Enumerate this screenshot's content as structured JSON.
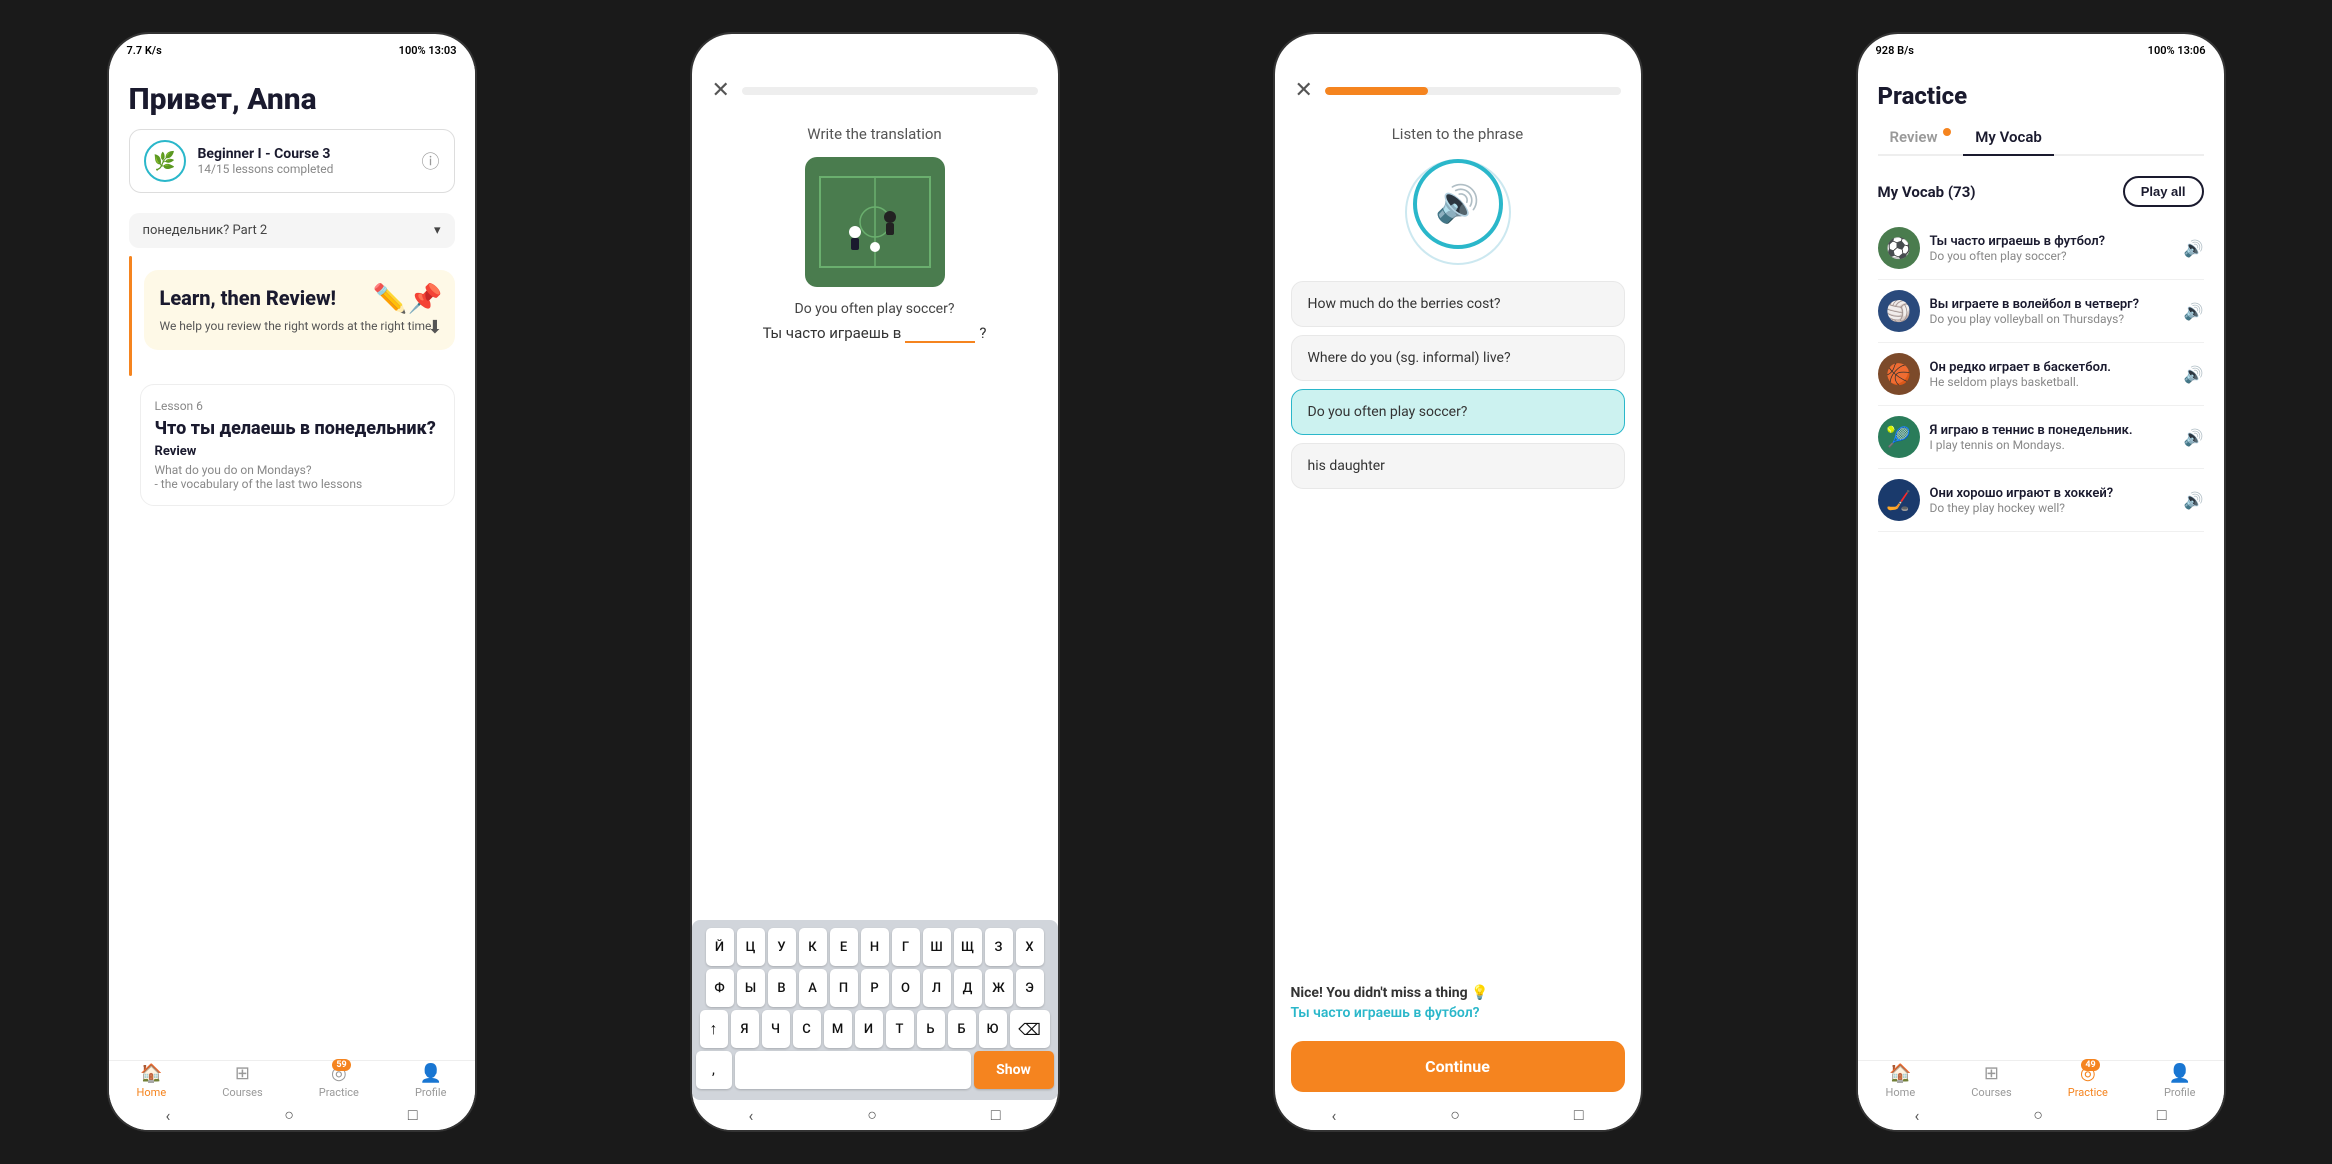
{
  "screens": [
    {
      "id": "screen1",
      "status_bar": {
        "left": "7.7 K/s",
        "right": "100% 13:03"
      },
      "greeting": "Привет, Anna",
      "course": {
        "name": "Beginner I - Course 3",
        "progress": "14/15 lessons completed"
      },
      "dropdown_text": "понедельник? Part 2",
      "review_card": {
        "title": "Learn, then Review!",
        "text": "We help you review the right words at the right time."
      },
      "lesson": {
        "number": "Lesson 6",
        "title": "Что ты делаешь в понедельник?",
        "subtitle": "Review",
        "desc": "What do you do on Mondays?\n- the vocabulary of the last two lessons"
      },
      "nav": {
        "home": "Home",
        "courses": "Courses",
        "practice": "Practice",
        "profile": "Profile",
        "badge": "59"
      }
    },
    {
      "id": "screen2",
      "instruction": "Write the translation",
      "phrase": "Do you often play soccer?",
      "translation_prefix": "Ты часто играешь в",
      "translation_suffix": "?",
      "keyboard_rows": [
        [
          "Й",
          "Ц",
          "У",
          "К",
          "Е",
          "Н",
          "Г",
          "Ш",
          "Щ",
          "З",
          "Х"
        ],
        [
          "Ф",
          "Ы",
          "В",
          "А",
          "П",
          "Р",
          "О",
          "Л",
          "Д",
          "Ж",
          "Э"
        ],
        [
          "↑",
          "Я",
          "Ч",
          "С",
          "М",
          "И",
          "Т",
          "Ь",
          "Б",
          "Ю",
          "⌫"
        ]
      ],
      "show_button": "Show"
    },
    {
      "id": "screen3",
      "instruction": "Listen to the phrase",
      "options": [
        "How much do the berries cost?",
        "Where do you (sg. informal) live?",
        "Do you often play soccer?",
        "his daughter"
      ],
      "selected_index": 2,
      "feedback": {
        "title": "Nice! You didn't miss a thing 💡",
        "correct": "Ты часто играешь в футбол?"
      },
      "continue_button": "Continue"
    },
    {
      "id": "screen4",
      "status_bar": {
        "left": "928 B/s",
        "right": "100% 13:06"
      },
      "title": "Practice",
      "tabs": [
        {
          "label": "Review",
          "has_dot": true,
          "active": false
        },
        {
          "label": "My Vocab",
          "has_dot": false,
          "active": true
        }
      ],
      "vocab_header": {
        "title": "My Vocab  (73)",
        "play_all": "Play all"
      },
      "vocab_items": [
        {
          "russian": "Ты часто играешь в футбол?",
          "english": "Do you often play soccer?",
          "emoji": "⚽"
        },
        {
          "russian": "Вы играете в волейбол в четверг?",
          "english": "Do you play volleyball on Thursdays?",
          "emoji": "🏐"
        },
        {
          "russian": "Он редко играет в баскетбол.",
          "english": "He seldom plays basketball.",
          "emoji": "🏀"
        },
        {
          "russian": "Я играю в теннис в понедельник.",
          "english": "I play tennis on Mondays.",
          "emoji": "🎾"
        },
        {
          "russian": "Они хорошо играют в хоккей?",
          "english": "Do they play hockey well?",
          "emoji": "🏒"
        }
      ],
      "nav": {
        "home": "Home",
        "courses": "Courses",
        "practice": "Practice",
        "profile": "Profile",
        "badge": "49"
      }
    }
  ]
}
